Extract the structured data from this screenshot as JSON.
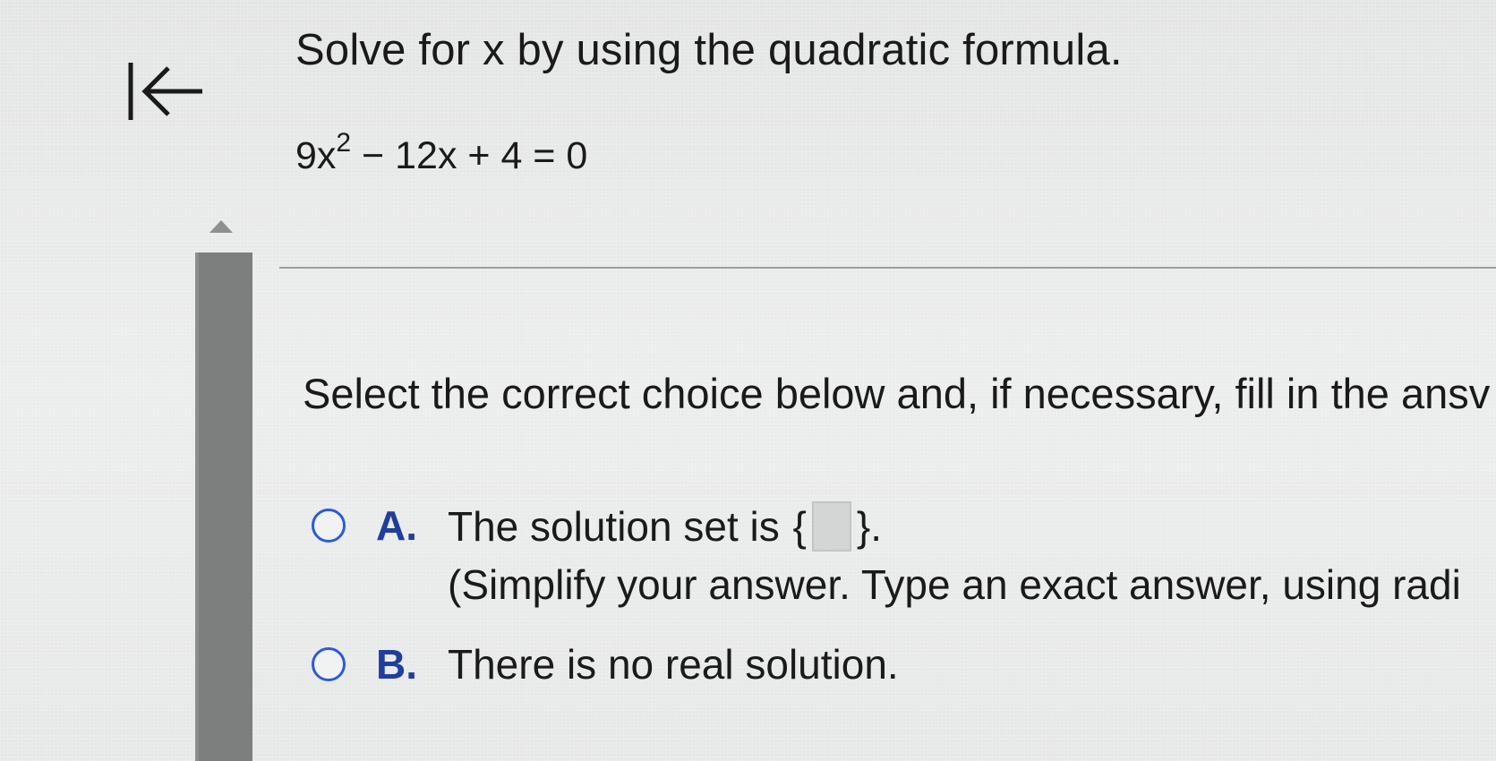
{
  "question": {
    "title": "Solve for x by using the quadratic formula.",
    "equation": {
      "base_lead": "9x",
      "exponent": "2",
      "rest": " − 12x + 4 = 0"
    }
  },
  "instruction": "Select the correct choice below and, if necessary, fill in the ansv",
  "choices": [
    {
      "letter": "A.",
      "text": "The solution set is ",
      "open_brace": "{",
      "close_brace": "}.",
      "answer_value": "",
      "hint": "(Simplify your answer. Type an exact answer, using radi"
    },
    {
      "letter": "B.",
      "text": "There is no real solution."
    }
  ],
  "icons": {
    "back": "first-page-arrow-icon",
    "scroll_up": "triangle-up-icon"
  },
  "colors": {
    "accent_radio": "#2a5bd7",
    "choice_letter": "#1f3e9e",
    "scrollbar_thumb": "#7d7e7e"
  }
}
